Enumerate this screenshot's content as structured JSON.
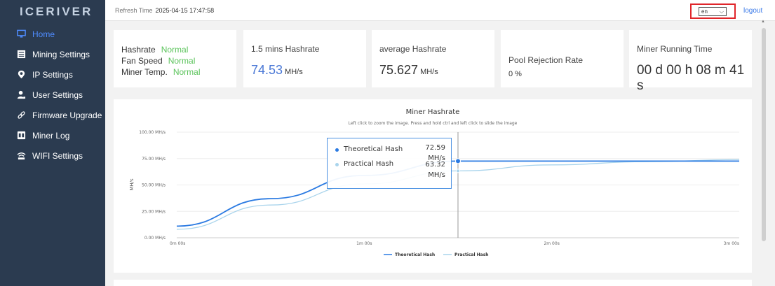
{
  "sidebar": {
    "logo": "ICERIVER",
    "items": [
      {
        "label": "Home",
        "icon": "monitor-icon"
      },
      {
        "label": "Mining Settings",
        "icon": "list-icon"
      },
      {
        "label": "IP Settings",
        "icon": "location-icon"
      },
      {
        "label": "User Settings",
        "icon": "user-icon"
      },
      {
        "label": "Firmware Upgrade",
        "icon": "link-icon"
      },
      {
        "label": "Miner Log",
        "icon": "log-icon"
      },
      {
        "label": "WIFI Settings",
        "icon": "wifi-icon"
      }
    ]
  },
  "header": {
    "refresh_label": "Refresh Time",
    "refresh_time": "2025-04-15 17:47:58",
    "language": "en",
    "logout": "logout"
  },
  "status": {
    "hashrate_label": "Hashrate",
    "hashrate_value": "Normal",
    "fan_label": "Fan Speed",
    "fan_value": "Normal",
    "temp_label": "Miner Temp.",
    "temp_value": "Normal"
  },
  "cards": {
    "mins_hashrate": {
      "label": "1.5 mins Hashrate",
      "value": "74.53",
      "unit": "MH/s"
    },
    "avg_hashrate": {
      "label": "average Hashrate",
      "value": "75.627",
      "unit": "MH/s"
    },
    "pool_rejection": {
      "label": "Pool Rejection Rate",
      "value": "0 %"
    },
    "running_time": {
      "label": "Miner Running Time",
      "value": "00 d 00 h 08 m 41 s"
    }
  },
  "colors": {
    "sidebar_bg": "#2b3b50",
    "accent": "#4f8cff",
    "normal_green": "#5cc45c",
    "theoretical": "#2a7ae2",
    "practical": "#a9d4ec"
  },
  "chart_data": {
    "type": "line",
    "title": "Miner Hashrate",
    "subtitle": "Left click to zoom the image. Press and hold ctrl and left click to slide the image",
    "y_ticks": [
      "0.00 MH/s",
      "25.00 MH/s",
      "50.00 MH/s",
      "75.00 MH/s",
      "100.00 MH/s"
    ],
    "ylabel": "MH/s",
    "ylim": [
      0,
      100
    ],
    "x_ticks": [
      "0m 00s",
      "1m 00s",
      "2m 00s",
      "3m 00s"
    ],
    "x_tick_seconds": [
      0,
      60,
      120,
      180
    ],
    "x": [
      0,
      30,
      60,
      90,
      120,
      150,
      180
    ],
    "series": [
      {
        "name": "Theoretical Hash",
        "values": [
          11,
          37,
          59,
          72.59,
          72.6,
          72.6,
          72.6
        ]
      },
      {
        "name": "Practical Hash",
        "values": [
          8,
          31,
          51,
          63.32,
          69,
          72,
          74
        ]
      }
    ],
    "tooltip": {
      "x_seconds": 90,
      "rows": [
        {
          "name": "Theoretical Hash",
          "value": "72.59",
          "unit": "MH/s"
        },
        {
          "name": "Practical Hash",
          "value": "63.32",
          "unit": "MH/s"
        }
      ]
    }
  }
}
